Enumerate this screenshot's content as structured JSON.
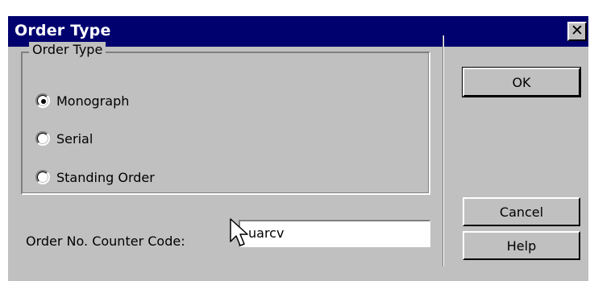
{
  "window": {
    "title": "Order Type",
    "close_glyph": "✕"
  },
  "group": {
    "label": "Order Type",
    "options": [
      {
        "label": "Monograph",
        "selected": true
      },
      {
        "label": "Serial",
        "selected": false
      },
      {
        "label": "Standing Order",
        "selected": false
      }
    ]
  },
  "buttons": {
    "ok": "OK",
    "cancel": "Cancel",
    "help": "Help"
  },
  "counter_code": {
    "label": "Order No. Counter Code:",
    "value": "uarcv"
  },
  "colors": {
    "titlebar": "#00006e",
    "face": "#c0c0c0"
  },
  "icons": {
    "pointer": "arrow-cursor-icon"
  }
}
